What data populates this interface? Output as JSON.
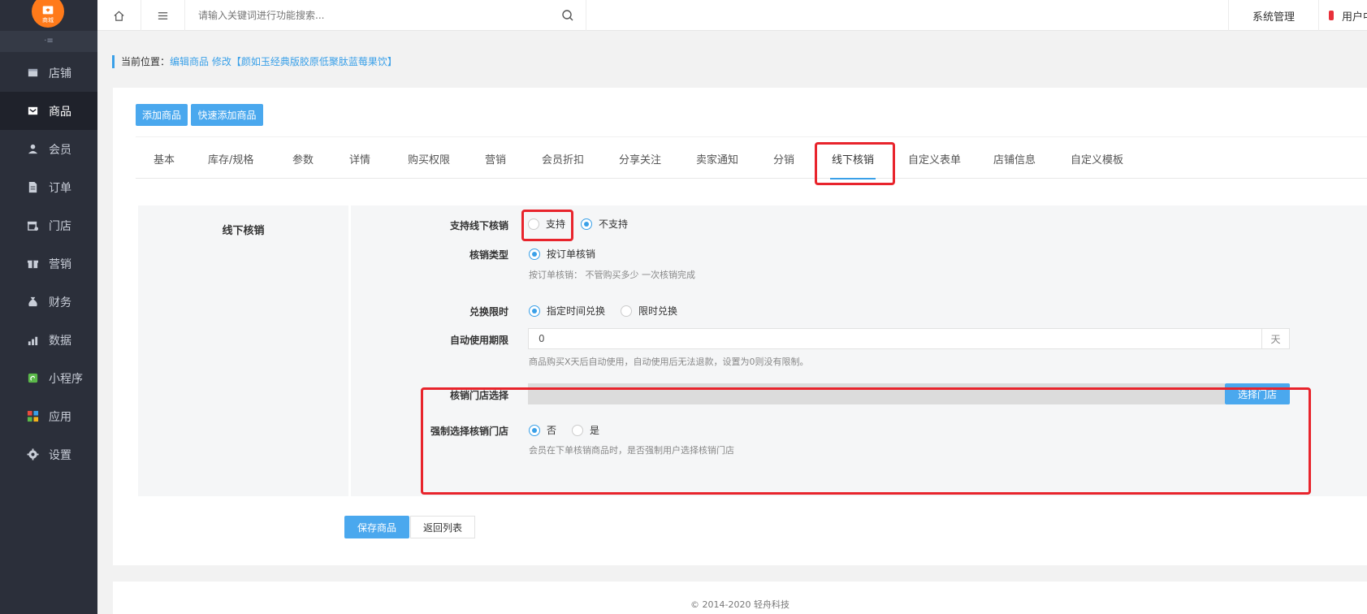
{
  "logo": {
    "text": "商城"
  },
  "sidebar": {
    "fold_icon": "·≡",
    "items": [
      {
        "label": "店铺",
        "icon": "store-icon"
      },
      {
        "label": "商品",
        "icon": "product-icon",
        "active": true
      },
      {
        "label": "会员",
        "icon": "member-icon"
      },
      {
        "label": "订单",
        "icon": "order-icon"
      },
      {
        "label": "门店",
        "icon": "shop-icon"
      },
      {
        "label": "营销",
        "icon": "gift-icon"
      },
      {
        "label": "财务",
        "icon": "money-bag-icon"
      },
      {
        "label": "数据",
        "icon": "chart-icon"
      },
      {
        "label": "小程序",
        "icon": "mini-program-icon"
      },
      {
        "label": "应用",
        "icon": "apps-icon"
      },
      {
        "label": "设置",
        "icon": "gear-icon"
      }
    ]
  },
  "topbar": {
    "search_placeholder": "请输入关键词进行功能搜索...",
    "system": "系统管理",
    "user": "用户中心"
  },
  "breadcrumb": {
    "label": "当前位置：",
    "path": "编辑商品 修改【颜如玉经典版胶原低聚肽蓝莓果饮】"
  },
  "actions": {
    "add": "添加商品",
    "quick_add": "快速添加商品"
  },
  "tabs": [
    "基本",
    "库存/规格",
    "参数",
    "详情",
    "购买权限",
    "营销",
    "会员折扣",
    "分享关注",
    "卖家通知",
    "分销",
    "线下核销",
    "自定义表单",
    "店铺信息",
    "自定义模板"
  ],
  "active_tab": "线下核销",
  "form": {
    "section": "线下核销",
    "support": {
      "label": "支持线下核销",
      "options": [
        "支持",
        "不支持"
      ],
      "selected": "不支持"
    },
    "verify_type": {
      "label": "核销类型",
      "options": [
        "按订单核销"
      ],
      "selected": "按订单核销",
      "hint": "按订单核销： 不管购买多少 一次核销完成"
    },
    "exchange_limit": {
      "label": "兑换限时",
      "options": [
        "指定时间兑换",
        "限时兑换"
      ],
      "selected": "指定时间兑换"
    },
    "auto_use": {
      "label": "自动使用期限",
      "value": "0",
      "unit": "天",
      "hint": "商品购买X天后自动使用，自动使用后无法退款，设置为0则没有限制。"
    },
    "store_select": {
      "label": "核销门店选择",
      "button": "选择门店"
    },
    "force_store": {
      "label": "强制选择核销门店",
      "options": [
        "否",
        "是"
      ],
      "selected": "否",
      "hint": "会员在下单核销商品时，是否强制用户选择核销门店"
    }
  },
  "buttons": {
    "save": "保存商品",
    "back": "返回列表"
  },
  "footer": "© 2014-2020 轻舟科技",
  "colors": {
    "sidebar": "#2b2f3a",
    "accent": "#3aa0e8",
    "button": "#4aa8ee",
    "highlight": "#e8242c",
    "logo": "#ff7a1a"
  }
}
